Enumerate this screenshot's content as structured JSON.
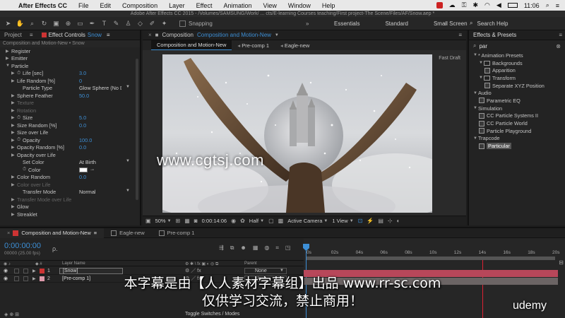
{
  "menubar": {
    "app": "After Effects CC",
    "items": [
      "File",
      "Edit",
      "Composition",
      "Layer",
      "Effect",
      "Animation",
      "View",
      "Window",
      "Help"
    ],
    "clock": "11:06"
  },
  "window_title": "Adobe After Effects CC 2015 - /Volumes/SAMSUNG/Work/ ... cts/E-learning Courses teaching/First project-The Scene/Files/AF/Snow.aep *",
  "toolbar": {
    "snapping": "Snapping",
    "workspaces": [
      "Essentials",
      "Standard",
      "Small Screen"
    ],
    "search_help": "Search Help"
  },
  "left_panel": {
    "tab_project": "Project",
    "tab_effect_controls": "Effect Controls",
    "effect_controls_target": "Snow",
    "subheader": "Composition and Motion-New • Snow",
    "rows": [
      {
        "label": "Register",
        "twirl": "▶",
        "indent": 1
      },
      {
        "label": "Emitter",
        "twirl": "▶",
        "indent": 1
      },
      {
        "label": "Particle",
        "twirl": "▼",
        "indent": 1
      },
      {
        "label": "Life [sec]",
        "twirl": "▶",
        "stopwatch": true,
        "indent": 2,
        "value": "3.0"
      },
      {
        "label": "Life Random [%]",
        "twirl": "▶",
        "indent": 2,
        "value": "0"
      },
      {
        "label": "Particle Type",
        "indent": 3,
        "dropdown": "Glow Sphere (No DOF)"
      },
      {
        "label": "Sphere Feather",
        "twirl": "▶",
        "indent": 2,
        "value": "50.0"
      },
      {
        "label": "Texture",
        "twirl": "▶",
        "indent": 2,
        "dim": true
      },
      {
        "label": "Rotation",
        "twirl": "▶",
        "indent": 2,
        "dim": true
      },
      {
        "label": "Size",
        "twirl": "▶",
        "stopwatch": true,
        "indent": 2,
        "value": "5.0"
      },
      {
        "label": "Size Random [%]",
        "twirl": "▶",
        "indent": 2,
        "value": "0.0"
      },
      {
        "label": "Size over Life",
        "twirl": "▶",
        "indent": 2
      },
      {
        "label": "Opacity",
        "twirl": "▶",
        "stopwatch": true,
        "indent": 2,
        "value": "100.0"
      },
      {
        "label": "Opacity Random [%]",
        "twirl": "▶",
        "indent": 2,
        "value": "0.0"
      },
      {
        "label": "Opacity over Life",
        "twirl": "▶",
        "indent": 2
      },
      {
        "label": "Set Color",
        "indent": 3,
        "dropdown": "At Birth"
      },
      {
        "label": "Color",
        "stopwatch": true,
        "indent": 3,
        "color": true
      },
      {
        "label": "Color Random",
        "twirl": "▶",
        "indent": 2,
        "value": "0.0"
      },
      {
        "label": "Color over Life",
        "twirl": "▶",
        "indent": 2,
        "dim": true
      },
      {
        "label": "Transfer Mode",
        "indent": 3,
        "dropdown": "Normal"
      },
      {
        "label": "Transfer Mode over Life",
        "twirl": "▶",
        "indent": 2,
        "dim": true
      },
      {
        "label": "Glow",
        "twirl": "▶",
        "indent": 2
      },
      {
        "label": "Streaklet",
        "twirl": "▶",
        "indent": 2
      }
    ]
  },
  "composition": {
    "panel_label": "Composition",
    "panel_name": "Composition and Motion-New",
    "tabs": [
      "Composition and Motion-New",
      "Pre-comp 1",
      "Eagle-new"
    ],
    "fast_draft": "Fast Draft",
    "footer": {
      "zoom": "50%",
      "timecode": "0:00:14:06",
      "resolution": "Half",
      "camera": "Active Camera",
      "views": "1 View"
    }
  },
  "watermark_text": "www.cgtsj.com",
  "effects_presets": {
    "title": "Effects & Presets",
    "search_value": "par",
    "items": [
      {
        "label": "* Animation Presets",
        "twirl": "▼",
        "indent": 0
      },
      {
        "label": "Backgrounds",
        "twirl": "▼",
        "indent": 1,
        "folder": true
      },
      {
        "label": "Apparition",
        "indent": 2,
        "effect": true
      },
      {
        "label": "Transform",
        "twirl": "▼",
        "indent": 1,
        "folder": true
      },
      {
        "label": "Separate XYZ Position",
        "indent": 2,
        "effect": true
      },
      {
        "label": "Audio",
        "twirl": "▼",
        "indent": 0
      },
      {
        "label": "Parametric EQ",
        "indent": 1,
        "effect": true
      },
      {
        "label": "Simulation",
        "twirl": "▼",
        "indent": 0
      },
      {
        "label": "CC Particle Systems II",
        "indent": 1,
        "effect": true
      },
      {
        "label": "CC Particle World",
        "indent": 1,
        "effect": true
      },
      {
        "label": "Particle Playground",
        "indent": 1,
        "effect": true
      },
      {
        "label": "Trapcode",
        "twirl": "▼",
        "indent": 0
      },
      {
        "label": "Particular",
        "indent": 1,
        "effect": true,
        "selected": true
      }
    ]
  },
  "timeline": {
    "tabs": [
      "Composition and Motion-New",
      "Eagle-new",
      "Pre-comp 1"
    ],
    "current_time": "0:00:00:00",
    "fps": "00000 (25.00 fps)",
    "search_glyph": "ρ.",
    "col_layer_name": "Layer Name",
    "col_parent": "Parent",
    "ruler": [
      "0s",
      "02s",
      "04s",
      "06s",
      "08s",
      "10s",
      "12s",
      "14s",
      "16s",
      "18s",
      "20s"
    ],
    "layers": [
      {
        "num": "1",
        "name": "[Snow]",
        "label_color": "#c33",
        "parent": "None",
        "solid": true,
        "bar_color": "#b8475a"
      },
      {
        "num": "2",
        "name": "[Pre-comp 1]",
        "label_color": "#d9a",
        "parent": "None",
        "solid": false,
        "bar_color": "#6b6464"
      }
    ],
    "toggle_label": "Toggle Switches / Modes"
  },
  "subtitles": {
    "line1": "本字幕是由【人人素材字幕组】出品  www.rr-sc.com",
    "line2": "仅供学习交流，禁止商用！"
  },
  "brand": "udemy",
  "colors": {
    "accent_blue": "#3d8fd6",
    "label_red": "#cc3333"
  }
}
